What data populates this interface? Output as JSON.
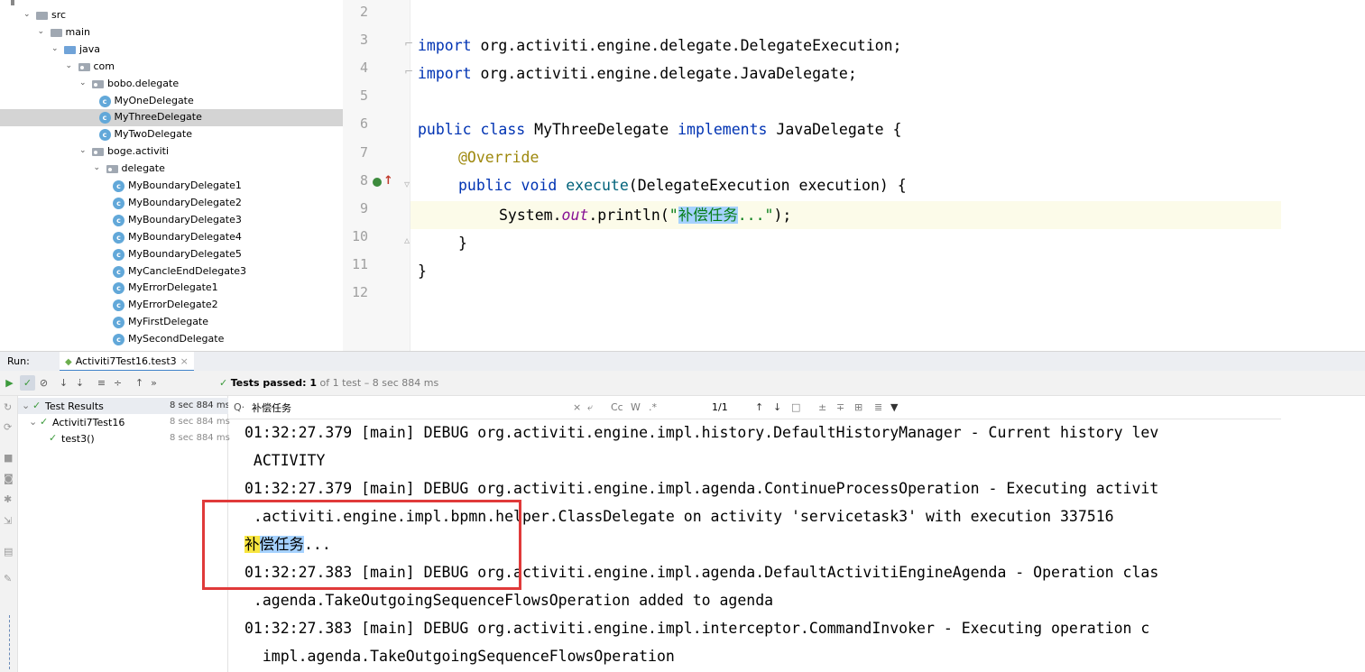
{
  "project_tree": [
    {
      "label": "src",
      "kind": "folder",
      "indent": 0
    },
    {
      "label": "main",
      "kind": "folder",
      "indent": 1
    },
    {
      "label": "java",
      "kind": "folder-blue",
      "indent": 2
    },
    {
      "label": "com",
      "kind": "package",
      "indent": 3
    },
    {
      "label": "bobo.delegate",
      "kind": "package",
      "indent": 4
    },
    {
      "label": "MyOneDelegate",
      "kind": "class",
      "indent": 5
    },
    {
      "label": "MyThreeDelegate",
      "kind": "class",
      "indent": 5,
      "selected": true
    },
    {
      "label": "MyTwoDelegate",
      "kind": "class",
      "indent": 5
    },
    {
      "label": "boge.activiti",
      "kind": "package",
      "indent": 4
    },
    {
      "label": "delegate",
      "kind": "package",
      "indent": 5
    },
    {
      "label": "MyBoundaryDelegate1",
      "kind": "class",
      "indent": 6
    },
    {
      "label": "MyBoundaryDelegate2",
      "kind": "class",
      "indent": 6
    },
    {
      "label": "MyBoundaryDelegate3",
      "kind": "class",
      "indent": 6
    },
    {
      "label": "MyBoundaryDelegate4",
      "kind": "class",
      "indent": 6
    },
    {
      "label": "MyBoundaryDelegate5",
      "kind": "class",
      "indent": 6
    },
    {
      "label": "MyCancleEndDelegate3",
      "kind": "class",
      "indent": 6
    },
    {
      "label": "MyErrorDelegate1",
      "kind": "class",
      "indent": 6
    },
    {
      "label": "MyErrorDelegate2",
      "kind": "class",
      "indent": 6
    },
    {
      "label": "MyFirstDelegate",
      "kind": "class",
      "indent": 6
    },
    {
      "label": "MySecondDelegate",
      "kind": "class",
      "indent": 6
    }
  ],
  "editor": {
    "line_numbers": [
      "2",
      "3",
      "4",
      "5",
      "6",
      "7",
      "8",
      "9",
      "10",
      "11",
      "12"
    ],
    "code": {
      "l3_kw": "import",
      "l3_rest": " org.activiti.engine.delegate.DelegateExecution;",
      "l4_kw": "import",
      "l4_rest": " org.activiti.engine.delegate.JavaDelegate;",
      "l6_kw1": "public class",
      "l6_mid": " MyThreeDelegate ",
      "l6_kw2": "implements",
      "l6_rest": " JavaDelegate {",
      "l7_anno": "@Override",
      "l8_kw": "public void",
      "l8_fn": " execute",
      "l8_rest": "(DelegateExecution execution) {",
      "l9_a": "System.",
      "l9_field": "out",
      "l9_b": ".println(",
      "l9_q1": "\"",
      "l9_sel": "补偿任务",
      "l9_q2": "...\"",
      "l9_c": ");",
      "l10": "}",
      "l11": "}"
    }
  },
  "run_window": {
    "run_label": "Run:",
    "tab_label": "Activiti7Test16.test3",
    "tests_passed_prefix": "Tests passed: ",
    "tests_passed_count": "1",
    "tests_passed_suffix": " of 1 test – 8 sec 884 ms"
  },
  "test_tree": [
    {
      "name": "Test Results",
      "time": "8 sec 884 ms"
    },
    {
      "name": "Activiti7Test16",
      "time": "8 sec 884 ms"
    },
    {
      "name": "test3()",
      "time": "8 sec 884 ms"
    }
  ],
  "find": {
    "query": "补偿任务",
    "match_count": "1/1",
    "case_label": "Cc",
    "word_label": "W",
    "regex_label": ".*"
  },
  "console": {
    "l1": "01:32:27.379 [main] DEBUG org.activiti.engine.impl.history.DefaultHistoryManager - Current history lev",
    "l2": " ACTIVITY",
    "l3": "01:32:27.379 [main] DEBUG org.activiti.engine.impl.agenda.ContinueProcessOperation - Executing activit",
    "l4": " .activiti.engine.impl.bpmn.helper.ClassDelegate on activity 'servicetask3' with execution 337516",
    "l5_a": "补",
    "l5_b": "偿任务",
    "l5_c": "...",
    "l6": "01:32:27.383 [main] DEBUG org.activiti.engine.impl.agenda.DefaultActivitiEngineAgenda - Operation clas",
    "l7": " .agenda.TakeOutgoingSequenceFlowsOperation added to agenda",
    "l8": "01:32:27.383 [main] DEBUG org.activiti.engine.impl.interceptor.CommandInvoker - Executing operation c",
    "l9": "  impl.agenda.TakeOutgoingSequenceFlowsOperation"
  }
}
